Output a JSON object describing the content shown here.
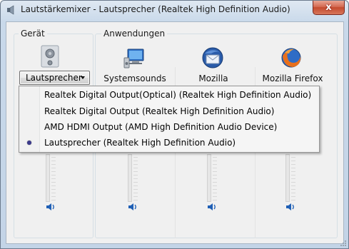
{
  "window": {
    "title": "Lautstärkemixer - Lautsprecher (Realtek High Definition Audio)",
    "close_symbol": "x"
  },
  "device_group": {
    "label": "Gerät",
    "icon": "speaker-device-icon",
    "selected_device": "Lautsprecher"
  },
  "apps_group": {
    "label": "Anwendungen",
    "apps": [
      {
        "name": "Systemsounds",
        "icon": "system-sounds-icon"
      },
      {
        "name": "Mozilla",
        "icon": "thunderbird-icon"
      },
      {
        "name": "Mozilla Firefox",
        "icon": "firefox-icon"
      }
    ]
  },
  "device_menu": {
    "items": [
      {
        "label": "Realtek Digital Output(Optical) (Realtek High Definition Audio)",
        "selected": false
      },
      {
        "label": "Realtek Digital Output (Realtek High Definition Audio)",
        "selected": false
      },
      {
        "label": "AMD HDMI Output (AMD High Definition Audio Device)",
        "selected": false
      },
      {
        "label": "Lautsprecher (Realtek High Definition Audio)",
        "selected": true
      }
    ]
  },
  "colors": {
    "accent_blue": "#1f5fb5",
    "close_red": "#c44a2e"
  }
}
